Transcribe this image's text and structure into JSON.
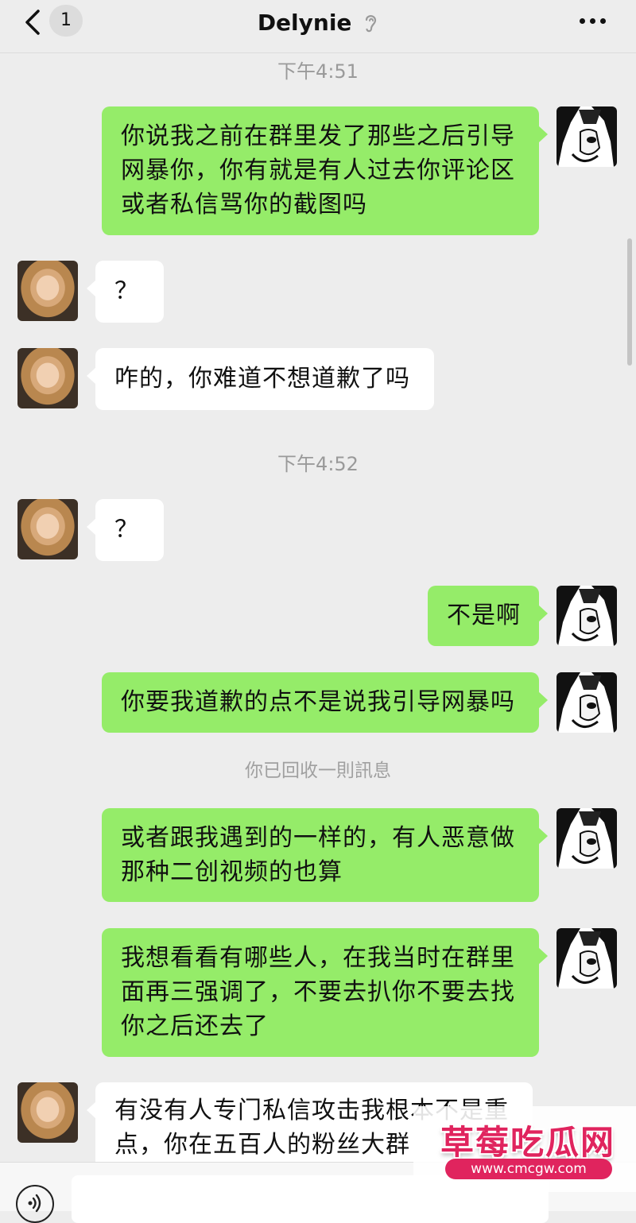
{
  "header": {
    "unread_count": "1",
    "title": "Delynie"
  },
  "colors": {
    "my_bubble": "#95ec69",
    "friend_bubble": "#ffffff",
    "background": "#ededed"
  },
  "messages": {
    "ts1": "下午4:51",
    "m1": {
      "sender": "me",
      "lines": [
        "你说我之前在群里发了那些之后引导",
        "网暴你，你有就是有人过去你评论区",
        "或者私信骂你的截图吗"
      ]
    },
    "m2": {
      "sender": "Delynie",
      "lines": [
        "？"
      ]
    },
    "m3": {
      "sender": "Delynie",
      "lines": [
        "咋的，你难道不想道歉了吗"
      ]
    },
    "ts2": "下午4:52",
    "m4": {
      "sender": "Delynie",
      "lines": [
        "？"
      ]
    },
    "m5": {
      "sender": "me",
      "lines": [
        "不是啊"
      ]
    },
    "m6": {
      "sender": "me",
      "lines": [
        "你要我道歉的点不是说我引导网暴吗"
      ]
    },
    "sys1": "你已回收一則訊息",
    "m7": {
      "sender": "me",
      "lines": [
        "或者跟我遇到的一样的，有人恶意做",
        "那种二创视频的也算"
      ]
    },
    "m8": {
      "sender": "me",
      "lines": [
        "我想看看有哪些人，在我当时在群里",
        "面再三强调了，不要去扒你不要去找",
        "你之后还去了"
      ]
    },
    "m9": {
      "sender": "Delynie",
      "lines": [
        "有没有人专门私信攻击我根本不是重",
        "点，你在五百人的粉丝大群"
      ]
    }
  },
  "icons": [
    "back-arrow-icon",
    "ear-icon",
    "more-icon",
    "voice-icon"
  ],
  "watermark": {
    "title": "草莓吃瓜网",
    "url": "www.cmcgw.com"
  }
}
